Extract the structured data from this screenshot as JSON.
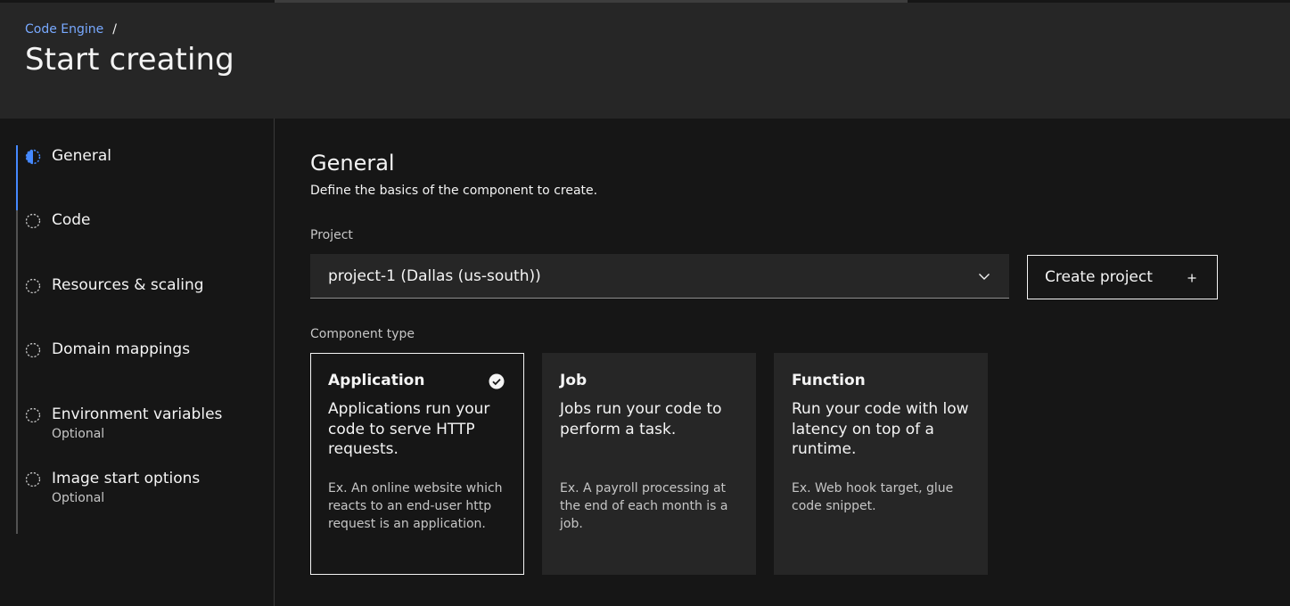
{
  "breadcrumb": {
    "parent": "Code Engine",
    "separator": "/"
  },
  "page_title": "Start creating",
  "progress": {
    "steps": [
      {
        "label": "General",
        "sub": "",
        "state": "current"
      },
      {
        "label": "Code",
        "sub": "",
        "state": "incomplete"
      },
      {
        "label": "Resources & scaling",
        "sub": "",
        "state": "incomplete"
      },
      {
        "label": "Domain mappings",
        "sub": "",
        "state": "incomplete"
      },
      {
        "label": "Environment variables",
        "sub": "Optional",
        "state": "incomplete"
      },
      {
        "label": "Image start options",
        "sub": "Optional",
        "state": "incomplete"
      }
    ]
  },
  "general": {
    "title": "General",
    "description": "Define the basics of the component to create.",
    "project_label": "Project",
    "project_value": "project-1 (Dallas (us-south))",
    "create_project_label": "Create project",
    "component_type_label": "Component type",
    "tiles": [
      {
        "title": "Application",
        "description": "Applications run your code to serve HTTP requests.",
        "example": "Ex. An online website which reacts to an end-user http request is an application.",
        "selected": true
      },
      {
        "title": "Job",
        "description": "Jobs run your code to perform a task.",
        "example": "Ex. A payroll processing at the end of each month is a job.",
        "selected": false
      },
      {
        "title": "Function",
        "description": "Run your code with low latency on top of a runtime.",
        "example": "Ex. Web hook target, glue code snippet.",
        "selected": false
      }
    ]
  },
  "colors": {
    "accent": "#4589ff",
    "link": "#78a9ff",
    "background": "#161616",
    "header_bg": "#262626"
  },
  "icons": {
    "current_step": "half-circle-icon",
    "incomplete_step": "dashed-circle-icon",
    "dropdown": "chevron-down-icon",
    "add": "plus-icon",
    "selected_tile": "checkmark-filled-icon"
  }
}
